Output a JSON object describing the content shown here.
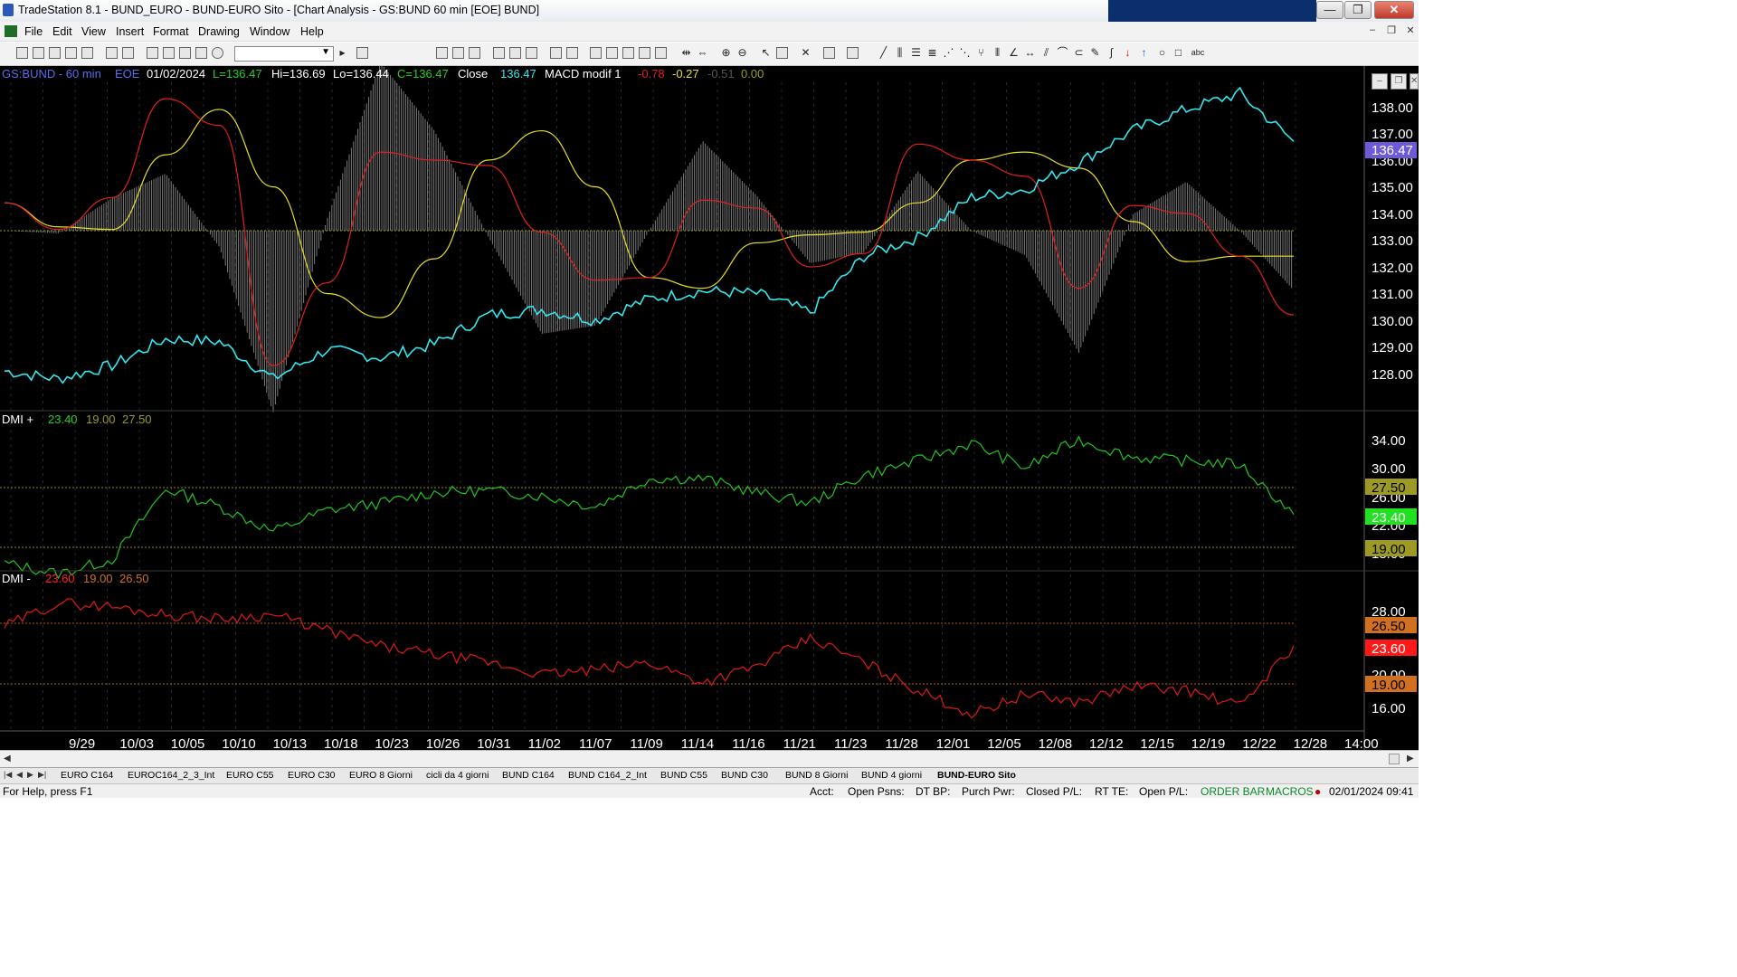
{
  "window": {
    "title": "TradeStation 8.1 - BUND_EURO - BUND-EURO Sito - [Chart Analysis - GS:BUND  60 min  [EOE] BUND]",
    "buttons": {
      "minimize": "—",
      "restore": "❐",
      "close": "✕"
    }
  },
  "menu": [
    "File",
    "Edit",
    "View",
    "Insert",
    "Format",
    "Drawing",
    "Window",
    "Help"
  ],
  "mdi_buttons": {
    "minimize": "–",
    "restore": "❐",
    "close": "✕"
  },
  "chart_header": {
    "symbol": "GS:BUND - 60 min",
    "session": "EOE",
    "date": "01/02/2024",
    "low_open": "L=136.47",
    "high": "Hi=136.69",
    "low": "Lo=136.44",
    "close": "C=136.47",
    "close_label": "Close",
    "close_value": "136.47",
    "macd_label": "MACD modif 1",
    "macd_values": [
      "-0.78",
      "-0.27",
      "-0.51",
      "0.00"
    ]
  },
  "dmi_plus_header": {
    "label": "DMI +",
    "values": [
      "23.40",
      "19.00",
      "27.50"
    ]
  },
  "dmi_minus_header": {
    "label": "DMI -",
    "values": [
      "23.60",
      "19.00",
      "26.50"
    ]
  },
  "price_axis": {
    "ticks": [
      "138.00",
      "137.00",
      "136.00",
      "135.00",
      "134.00",
      "133.00",
      "132.00",
      "131.00",
      "130.00",
      "129.00",
      "128.00"
    ],
    "last_price": "136.47"
  },
  "dmi_plus_axis": {
    "ticks": [
      "34.00",
      "30.00",
      "26.00",
      "22.00",
      "18.00"
    ],
    "badges": [
      "27.50",
      "23.40",
      "19.00"
    ]
  },
  "dmi_minus_axis": {
    "ticks": [
      "28.00",
      "20.00",
      "16.00"
    ],
    "badges": [
      "26.50",
      "23.60",
      "19.00"
    ]
  },
  "time_axis": [
    "9/29",
    "10/03",
    "10/05",
    "10/10",
    "10/13",
    "10/18",
    "10/23",
    "10/26",
    "10/31",
    "11/02",
    "11/07",
    "11/09",
    "11/14",
    "11/16",
    "11/21",
    "11/23",
    "11/28",
    "12/01",
    "12/05",
    "12/08",
    "12/12",
    "12/15",
    "12/19",
    "12/22",
    "12/28",
    "14:00"
  ],
  "colors": {
    "price": "#31e8f0",
    "macd_fast": "#e02020",
    "macd_slow": "#e8e020",
    "histogram": "#8a8a8a",
    "dmi_plus": "#22c422",
    "dmi_minus": "#e01818",
    "last_price_bg": "#6e5ad8",
    "header_symbol": "#5a6cf0"
  },
  "chart_data": [
    {
      "type": "line",
      "title": "GS:BUND - 60 min",
      "x": [
        "9/29",
        "10/03",
        "10/05",
        "10/10",
        "10/13",
        "10/18",
        "10/23",
        "10/26",
        "10/31",
        "11/02",
        "11/07",
        "11/09",
        "11/14",
        "11/16",
        "11/21",
        "11/23",
        "11/28",
        "12/01",
        "12/05",
        "12/08",
        "12/12",
        "12/15",
        "12/19",
        "12/22",
        "12/28"
      ],
      "series": [
        {
          "name": "Close",
          "values": [
            128.1,
            127.8,
            128.3,
            129.3,
            129.2,
            127.8,
            128.9,
            128.6,
            129.1,
            130.2,
            130.4,
            130.0,
            130.8,
            131.1,
            131.0,
            130.3,
            132.4,
            133.1,
            134.6,
            134.9,
            135.9,
            137.1,
            137.9,
            138.5,
            136.7
          ]
        },
        {
          "name": "MACD modif 1",
          "values": [
            134.4,
            133.4,
            134.6,
            138.3,
            137.3,
            128.3,
            131.4,
            136.3,
            136.0,
            135.8,
            133.3,
            131.5,
            131.6,
            134.5,
            134.2,
            132.0,
            132.5,
            136.6,
            136.0,
            135.4,
            131.2,
            134.3,
            134.0,
            132.4,
            130.2
          ]
        },
        {
          "name": "MACD signal",
          "values": [
            134.4,
            133.5,
            133.4,
            136.2,
            137.9,
            135.0,
            131.0,
            130.1,
            132.3,
            136.0,
            137.1,
            135.0,
            131.6,
            131.2,
            132.9,
            133.2,
            133.3,
            134.4,
            136.0,
            136.3,
            135.7,
            133.7,
            132.2,
            132.4,
            132.4
          ]
        }
      ],
      "ylim": [
        127,
        139
      ]
    },
    {
      "type": "line",
      "title": "DMI +",
      "x": [
        "9/29",
        "10/03",
        "10/05",
        "10/10",
        "10/13",
        "10/18",
        "10/23",
        "10/26",
        "10/31",
        "11/02",
        "11/07",
        "11/09",
        "11/14",
        "11/16",
        "11/21",
        "11/23",
        "11/28",
        "12/01",
        "12/05",
        "12/08",
        "12/12",
        "12/15",
        "12/19",
        "12/22",
        "12/28"
      ],
      "series": [
        {
          "name": "DMI +",
          "values": [
            16.5,
            15.0,
            17.0,
            27.0,
            24.5,
            21.0,
            24.0,
            25.0,
            26.5,
            26.8,
            26.0,
            24.5,
            28.5,
            28.5,
            26.5,
            25.0,
            29.0,
            31.0,
            33.5,
            30.0,
            34.0,
            31.5,
            31.0,
            30.5,
            23.4
          ]
        }
      ],
      "ylim": [
        14,
        36
      ]
    },
    {
      "type": "line",
      "title": "DMI -",
      "x": [
        "9/29",
        "10/03",
        "10/05",
        "10/10",
        "10/13",
        "10/18",
        "10/23",
        "10/26",
        "10/31",
        "11/02",
        "11/07",
        "11/09",
        "11/14",
        "11/16",
        "11/21",
        "11/23",
        "11/28",
        "12/01",
        "12/05",
        "12/08",
        "12/12",
        "12/15",
        "12/19",
        "12/22",
        "12/28"
      ],
      "series": [
        {
          "name": "DMI -",
          "values": [
            26.0,
            29.0,
            28.5,
            27.5,
            27.0,
            27.5,
            25.5,
            23.5,
            22.5,
            21.5,
            20.0,
            20.5,
            21.5,
            19.0,
            21.0,
            24.5,
            21.5,
            18.0,
            15.0,
            17.5,
            16.5,
            18.5,
            18.0,
            16.0,
            23.6
          ]
        }
      ],
      "ylim": [
        14,
        32
      ]
    }
  ],
  "sheet_tabs": [
    "EURO C164",
    "EUROC164_2_3_Int",
    "EURO C55",
    "EURO C30",
    "EURO 8 Giorni",
    "cicli da 4 giorni",
    "BUND C164",
    "BUND C164_2_Int",
    "BUND C55",
    "BUND  C30",
    "BUND 8 Giorni",
    "BUND 4 giorni",
    "BUND-EURO Sito"
  ],
  "status": {
    "help": "For Help, press F1",
    "acct": "Acct:",
    "open_psns": "Open Psns:",
    "dt_bp": "DT BP:",
    "purch_pwr": "Purch Pwr:",
    "closed_pl": "Closed P/L:",
    "rt_te": "RT TE:",
    "open_pl": "Open P/L:",
    "order_bar": "ORDER BAR",
    "macros": "MACROS",
    "clock": "02/01/2024 09:41"
  }
}
